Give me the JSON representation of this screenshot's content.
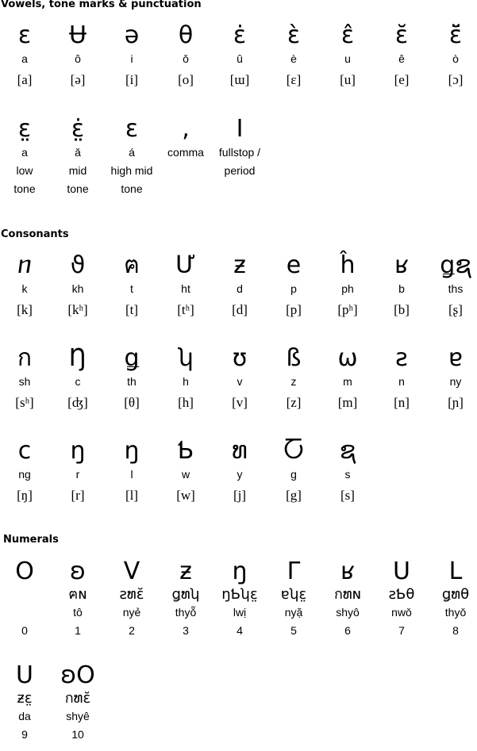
{
  "sections": {
    "vowels": {
      "title": "Vowels, tone marks & punctuation",
      "row1": [
        {
          "glyph": "ɛ",
          "latin": "a",
          "ipa": "[a]"
        },
        {
          "glyph": "Ʉ",
          "latin": "ô",
          "ipa": "[ə]"
        },
        {
          "glyph": "ə",
          "latin": "i",
          "ipa": "[i]"
        },
        {
          "glyph": "θ",
          "latin": "ǒ",
          "ipa": "[o]"
        },
        {
          "glyph": "ɛ̇",
          "latin": "û",
          "ipa": "[ɯ]"
        },
        {
          "glyph": "ɛ̀",
          "latin": "è",
          "ipa": "[ɛ]"
        },
        {
          "glyph": "ɛ̂",
          "latin": "u",
          "ipa": "[u]"
        },
        {
          "glyph": "ɛ̆",
          "latin": "ê",
          "ipa": "[e]"
        },
        {
          "glyph": "ɛ̆̈",
          "latin": "ò",
          "ipa": "[ɔ]"
        }
      ],
      "row2": [
        {
          "glyph": "ɛ̤",
          "lines": [
            "a",
            "low",
            "tone"
          ]
        },
        {
          "glyph": "ɛ̤̇",
          "lines": [
            "ǎ",
            "mid",
            "tone"
          ]
        },
        {
          "glyph": "ɛ",
          "lines": [
            "á",
            "high mid",
            "tone"
          ]
        },
        {
          "glyph": ",",
          "lines": [
            "comma"
          ]
        },
        {
          "glyph": "I",
          "lines": [
            "fullstop /",
            "period"
          ]
        }
      ]
    },
    "consonants": {
      "title": "Consonants",
      "rows": [
        [
          {
            "glyph": "ⴖ",
            "latin": "k",
            "ipa": "[k]"
          },
          {
            "glyph": "ϑ",
            "latin": "kh",
            "ipa": "[kʰ]"
          },
          {
            "glyph": "ฅ",
            "latin": "t",
            "ipa": "[t]"
          },
          {
            "glyph": "Ư",
            "latin": "ht",
            "ipa": "[tʰ]"
          },
          {
            "glyph": "ƶ",
            "latin": "d",
            "ipa": "[d]"
          },
          {
            "glyph": "e",
            "latin": "p",
            "ipa": "[p]"
          },
          {
            "glyph": "ĥ",
            "latin": "ph",
            "ipa": "[pʰ]"
          },
          {
            "glyph": "ʁ",
            "latin": "b",
            "ipa": "[b]"
          },
          {
            "glyph": "ǥຊ",
            "latin": "ths",
            "ipa": "[ʂ]"
          }
        ],
        [
          {
            "glyph": "ก",
            "latin": "sh",
            "ipa": "[sʰ]"
          },
          {
            "glyph": "Ŋ",
            "latin": "c",
            "ipa": "[ʤ]"
          },
          {
            "glyph": "ǥ",
            "latin": "th",
            "ipa": "[θ]"
          },
          {
            "glyph": "ʮ",
            "latin": "h",
            "ipa": "[h]"
          },
          {
            "glyph": "ʊ",
            "latin": "v",
            "ipa": "[v]"
          },
          {
            "glyph": "ß",
            "latin": "z",
            "ipa": "[z]"
          },
          {
            "glyph": "ω",
            "latin": "m",
            "ipa": "[m]"
          },
          {
            "glyph": "ƨ",
            "latin": "n",
            "ipa": "[n]"
          },
          {
            "glyph": "ɐ",
            "latin": "ny",
            "ipa": "[ɲ]"
          }
        ],
        [
          {
            "glyph": "c",
            "latin": "ng",
            "ipa": "[ŋ]"
          },
          {
            "glyph": "ŋ",
            "latin": "r",
            "ipa": "[r]"
          },
          {
            "glyph": "ŋ",
            "latin": "l",
            "ipa": "[l]"
          },
          {
            "glyph": "Ƅ",
            "latin": "w",
            "ipa": "[w]"
          },
          {
            "glyph": "ທ",
            "latin": "y",
            "ipa": "[j]"
          },
          {
            "glyph": "Ⴀ",
            "latin": "g",
            "ipa": "[g]"
          },
          {
            "glyph": "ຊ",
            "latin": "s",
            "ipa": "[s]"
          }
        ]
      ]
    },
    "numerals": {
      "title": "Numerals",
      "row1": [
        {
          "glyph": "O",
          "word": "",
          "latin": "",
          "number": "0"
        },
        {
          "glyph": "ʚ",
          "word": "ฅɴ",
          "latin": "tô",
          "number": "1"
        },
        {
          "glyph": "V",
          "word": "ƨທɛ̆",
          "latin": "nyẻ",
          "number": "2"
        },
        {
          "glyph": "ƶ",
          "word": "ǥທʮ",
          "latin": "thyǒ̃",
          "number": "3"
        },
        {
          "glyph": "ŋ",
          "word": "ŋƄʮɛ̤",
          "latin": "lwị",
          "number": "4"
        },
        {
          "glyph": "Γ",
          "word": "ɐʮɛ̤",
          "latin": "nyặ",
          "number": "5"
        },
        {
          "glyph": "ʁ",
          "word": "กທɴ",
          "latin": "shyô",
          "number": "6"
        },
        {
          "glyph": "U",
          "word": "ƨƄθ",
          "latin": "nwǒ",
          "number": "7"
        },
        {
          "glyph": "L",
          "word": "ǥທθ",
          "latin": "thyǒ",
          "number": "8"
        }
      ],
      "row2": [
        {
          "glyph": "U",
          "word": "ƶɛ̤",
          "latin": "da",
          "number": "9"
        },
        {
          "glyph": "ʚO",
          "word": "กທɛ̆",
          "latin": "shyê",
          "number": "10"
        }
      ]
    }
  }
}
